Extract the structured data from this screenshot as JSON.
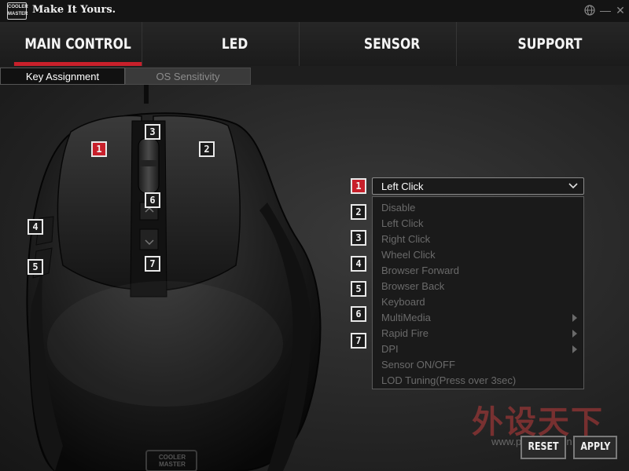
{
  "titlebar": {
    "logo_line1": "COOLER",
    "logo_line2": "MASTER",
    "tagline": "Make It Yours.",
    "globe_icon": "globe-icon",
    "minimize_label": "—",
    "close_label": "✕"
  },
  "nav": {
    "tabs": [
      {
        "label": "MAIN CONTROL",
        "active": true
      },
      {
        "label": "LED",
        "active": false
      },
      {
        "label": "SENSOR",
        "active": false
      },
      {
        "label": "SUPPORT",
        "active": false
      }
    ]
  },
  "subtabs": [
    {
      "label": "Key Assignment",
      "active": true
    },
    {
      "label": "OS Sensitivity",
      "active": false
    }
  ],
  "mouse_buttons": [
    "1",
    "2",
    "3",
    "4",
    "5",
    "6",
    "7"
  ],
  "mouse_logo": "COOLER MASTER",
  "assignment": {
    "numbers": [
      "1",
      "2",
      "3",
      "4",
      "5",
      "6",
      "7"
    ],
    "selected_button": "1",
    "current_value": "Left Click",
    "options": [
      {
        "label": "Disable",
        "submenu": false
      },
      {
        "label": "Left Click",
        "submenu": false
      },
      {
        "label": "Right Click",
        "submenu": false
      },
      {
        "label": "Wheel Click",
        "submenu": false
      },
      {
        "label": "Browser Forward",
        "submenu": false
      },
      {
        "label": "Browser Back",
        "submenu": false
      },
      {
        "label": "Keyboard",
        "submenu": false
      },
      {
        "label": "MultiMedia",
        "submenu": true
      },
      {
        "label": "Rapid Fire",
        "submenu": true
      },
      {
        "label": "DPI",
        "submenu": true
      },
      {
        "label": "Sensor ON/OFF",
        "submenu": false
      },
      {
        "label": "LOD Tuning(Press over 3sec)",
        "submenu": false
      }
    ]
  },
  "buttons": {
    "reset": "RESET",
    "apply": "APPLY"
  },
  "watermark": {
    "text": "外设天下",
    "sub": "www.pcwaishe.cn"
  },
  "colors": {
    "accent": "#c8202b",
    "background": "#1e1e1e"
  }
}
